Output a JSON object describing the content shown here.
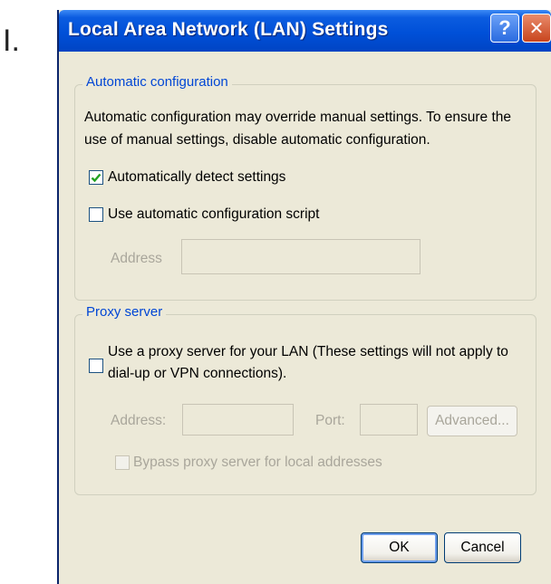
{
  "step_label": "I.",
  "window": {
    "title": "Local Area Network (LAN) Settings",
    "help_glyph": "?",
    "close_glyph": "✕"
  },
  "auto_config": {
    "group_label": "Automatic configuration",
    "description_line1": "Automatic configuration may override manual settings.  To ensure the",
    "description_line2": "use of manual settings, disable automatic configuration.",
    "detect_label": "Automatically detect settings",
    "detect_checked": true,
    "script_label": "Use automatic configuration script",
    "script_checked": false,
    "address_label": "Address",
    "address_value": ""
  },
  "proxy": {
    "group_label": "Proxy server",
    "use_proxy_line1": "Use a proxy server for your LAN (These settings will not apply to",
    "use_proxy_line2": "dial-up or VPN connections).",
    "use_proxy_checked": false,
    "address_label": "Address:",
    "address_value": "",
    "port_label": "Port:",
    "port_value": "",
    "advanced_label": "Advanced...",
    "bypass_label": "Bypass proxy server for local addresses",
    "bypass_checked": false
  },
  "footer": {
    "ok_label": "OK",
    "cancel_label": "Cancel"
  },
  "colors": {
    "titlebar": "#0050d8",
    "dialog_bg": "#ece9d8",
    "group_label": "#0046d5",
    "check_mark": "#21a121"
  }
}
